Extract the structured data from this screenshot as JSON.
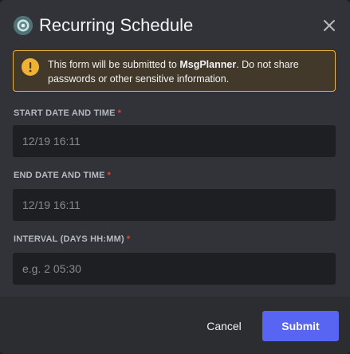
{
  "modal": {
    "title": "Recurring Schedule",
    "app_icon": "msgplanner-app-icon",
    "close_icon": "close-icon"
  },
  "notice": {
    "icon": "warning-icon",
    "text_before": "This form will be submitted to ",
    "app_name": "MsgPlanner",
    "text_after": ". Do not share passwords or other sensitive information."
  },
  "fields": {
    "start": {
      "label": "START DATE AND TIME",
      "required_mark": "*",
      "placeholder": "12/19 16:11",
      "value": ""
    },
    "end": {
      "label": "END DATE AND TIME",
      "required_mark": "*",
      "placeholder": "12/19 16:11",
      "value": ""
    },
    "interval": {
      "label": "INTERVAL (DAYS HH:MM)",
      "required_mark": "*",
      "placeholder": "e.g. 2 05:30",
      "value": ""
    }
  },
  "footer": {
    "cancel_label": "Cancel",
    "submit_label": "Submit"
  },
  "colors": {
    "modal_bg": "#313338",
    "footer_bg": "#2b2d31",
    "input_bg": "#1e1f22",
    "warning": "#f0b232",
    "required": "#f23f43",
    "brand": "#5865f2"
  }
}
